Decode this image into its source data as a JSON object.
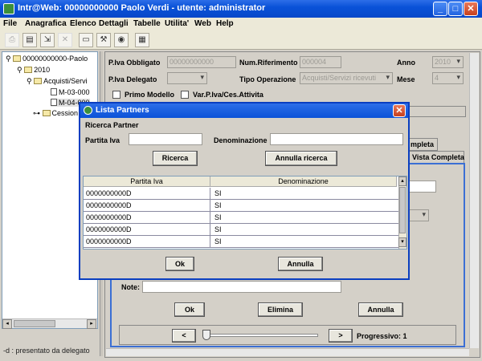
{
  "window": {
    "title": "Intr@Web: 00000000000  Paolo Verdi - utente: administrator"
  },
  "menu": [
    "File",
    "Anagrafica",
    "Elenco",
    "Dettagli",
    "Tabelle",
    "Utilita'",
    "Web",
    "Help"
  ],
  "tree": {
    "root": "00000000000-Paolo",
    "year": "2010",
    "folder1": "Acquisti/Servi",
    "doc1": "M-03-000",
    "doc2": "M-04-000",
    "folder2": "Cession"
  },
  "status": "-d : presentato da delegato",
  "form": {
    "piva_obbligato_label": "P.Iva Obbligato",
    "piva_obbligato_value": "00000000000",
    "num_riferimento_label": "Num.Riferimento",
    "num_riferimento_value": "000004",
    "anno_label": "Anno",
    "anno_value": "2010",
    "piva_delegato_label": "P.Iva Delegato",
    "tipo_operazione_label": "Tipo Operazione",
    "tipo_operazione_value": "Acquisti/Servizi ricevuti",
    "mese_label": "Mese",
    "mese_value": "4",
    "primo_modello_label": "Primo Modello",
    "var_piva_label": "Var.P.Iva/Ces.Attivita",
    "tab_completa": "mpleta",
    "tab_vista_completa": "Vista Completa",
    "note_label": "Note:",
    "ok": "Ok",
    "elimina": "Elimina",
    "annulla": "Annulla",
    "prev": "<",
    "next": ">",
    "progressivo": "Progressivo: 1"
  },
  "dialog": {
    "title": "Lista Partners",
    "section": "Ricerca Partner",
    "partita_iva_label": "Partita Iva",
    "denominazione_label": "Denominazione",
    "ricerca_button": "Ricerca",
    "annulla_ricerca_button": "Annulla ricerca",
    "columns": [
      "Partita Iva",
      "Denominazione"
    ],
    "rows": [
      [
        "0000000000D",
        "SI"
      ],
      [
        "0000000000D",
        "SI"
      ],
      [
        "0000000000D",
        "SI"
      ],
      [
        "0000000000D",
        "SI"
      ],
      [
        "0000000000D",
        "SI"
      ]
    ],
    "ok_button": "Ok",
    "annulla_button": "Annulla"
  }
}
